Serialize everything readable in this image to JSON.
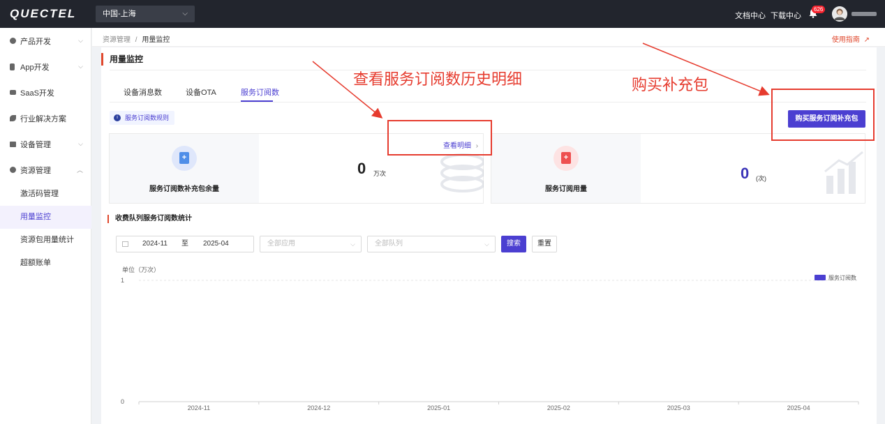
{
  "topbar": {
    "logo": "QUECTEL",
    "region": "中国-上海",
    "links": [
      "文档中心",
      "下载中心"
    ],
    "notification_count": "626"
  },
  "sidebar": {
    "items": [
      {
        "label": "产品开发",
        "icon": "cube-icon",
        "expandable": true
      },
      {
        "label": "App开发",
        "icon": "phone-icon",
        "expandable": true
      },
      {
        "label": "SaaS开发",
        "icon": "monitor-icon",
        "expandable": false
      },
      {
        "label": "行业解决方案",
        "icon": "leaf-icon",
        "expandable": false
      },
      {
        "label": "设备管理",
        "icon": "server-icon",
        "expandable": true
      },
      {
        "label": "资源管理",
        "icon": "resource-icon",
        "expandable": true,
        "expanded": true
      }
    ],
    "sub_items": [
      "激活码管理",
      "用量监控",
      "资源包用量统计",
      "超额账单"
    ],
    "active_sub": "用量监控"
  },
  "breadcrumb": {
    "parent": "资源管理",
    "separator": "/",
    "current": "用量监控"
  },
  "guide_link": "使用指南",
  "page_title": "用量监控",
  "tabs": [
    "设备消息数",
    "设备OTA",
    "服务订阅数"
  ],
  "active_tab": "服务订阅数",
  "rule_chip": "服务订阅数规则",
  "buy_button": "购买服务订阅补充包",
  "stats": {
    "left": {
      "label": "服务订阅数补充包余量",
      "value": "0",
      "unit": "万次",
      "link": "查看明细"
    },
    "right": {
      "label": "服务订阅用量",
      "value": "0",
      "unit": "(次)"
    }
  },
  "section_title": "收费队列服务订阅数统计",
  "filters": {
    "date_start": "2024-11",
    "date_sep": "至",
    "date_end": "2025-04",
    "app_placeholder": "全部应用",
    "queue_placeholder": "全部队列",
    "search": "搜索",
    "reset": "重置"
  },
  "annotations": {
    "detail": "查看服务订阅数历史明细",
    "buy": "购买补充包"
  },
  "colors": {
    "accent": "#4b3fd1",
    "annotation": "#e63b2e",
    "brand_red": "#e0482d"
  },
  "chart_data": {
    "type": "bar",
    "unit_label": "单位（万次）",
    "categories": [
      "2024-11",
      "2024-12",
      "2025-01",
      "2025-02",
      "2025-03",
      "2025-04"
    ],
    "series": [
      {
        "name": "服务订阅数",
        "values": [
          0,
          0,
          0,
          0,
          0,
          0
        ]
      }
    ],
    "ylim": [
      0,
      1
    ],
    "yticks": [
      0,
      1
    ],
    "legend": "top-right",
    "grid": true
  }
}
